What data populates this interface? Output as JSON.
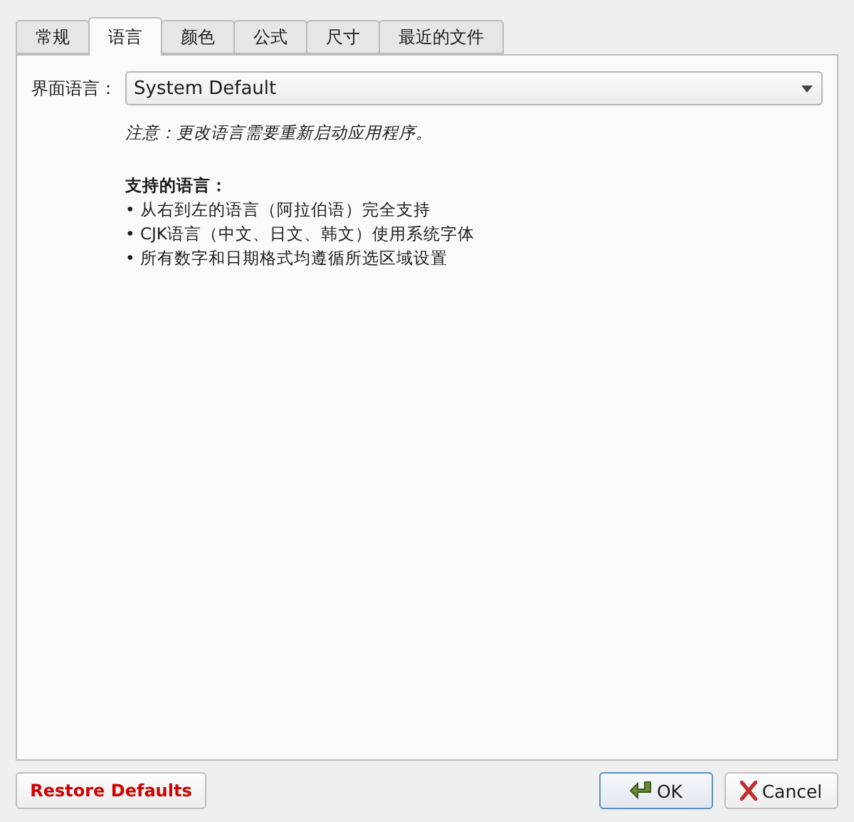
{
  "tabs": [
    {
      "label": "常规",
      "selected": false
    },
    {
      "label": "语言",
      "selected": true
    },
    {
      "label": "颜色",
      "selected": false
    },
    {
      "label": "公式",
      "selected": false
    },
    {
      "label": "尺寸",
      "selected": false
    },
    {
      "label": "最近的文件",
      "selected": false
    }
  ],
  "language": {
    "label": "界面语言：",
    "value": "System Default"
  },
  "note": "注意：更改语言需要重新启动应用程序。",
  "supported": {
    "heading": "支持的语言：",
    "items": [
      "• 从右到左的语言（阿拉伯语）完全支持",
      "• CJK语言（中文、日文、韩文）使用系统字体",
      "• 所有数字和日期格式均遵循所选区域设置"
    ]
  },
  "buttons": {
    "restore": "Restore Defaults",
    "ok": "OK",
    "cancel": "Cancel"
  }
}
